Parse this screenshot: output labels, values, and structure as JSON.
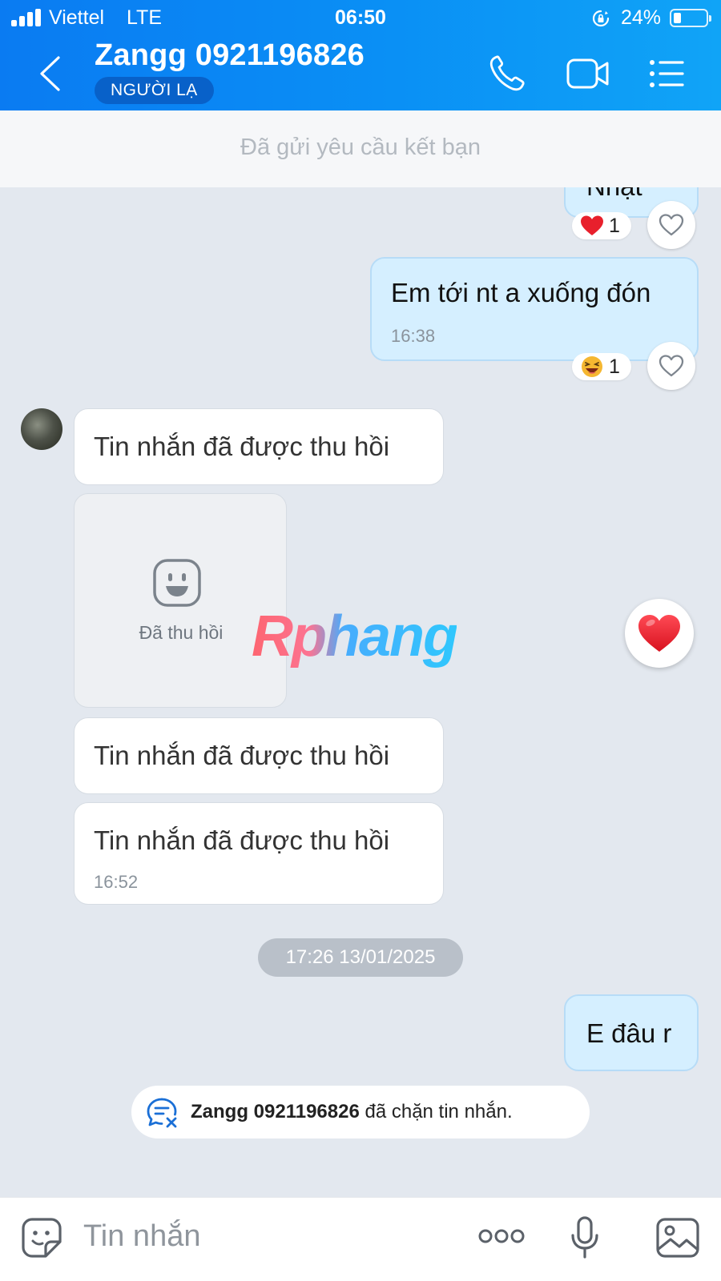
{
  "status_bar": {
    "carrier": "Viettel",
    "network": "LTE",
    "time": "06:50",
    "battery_percent": "24%",
    "battery_level": 0.24
  },
  "header": {
    "title": "Zangg 0921196826",
    "badge": "NGƯỜI LẠ",
    "icons": [
      "back-icon",
      "phone-icon",
      "video-call-icon",
      "menu-list-icon"
    ]
  },
  "friend_request": {
    "label": "Đã gửi yêu cầu kết bạn"
  },
  "messages": {
    "m0": {
      "text": "Nhật",
      "reaction_count": "1",
      "reaction": "red-heart"
    },
    "m1": {
      "text": "Em tới nt a xuống đón",
      "time": "16:38",
      "reaction_count": "1",
      "reaction": "laughing-face"
    },
    "m2": {
      "text": "Tin nhắn đã được thu hồi"
    },
    "m3": {
      "label": "Đã thu hồi"
    },
    "m4": {
      "text": "Tin nhắn đã được thu hồi"
    },
    "m5": {
      "text": "Tin nhắn đã được thu hồi",
      "time": "16:52"
    },
    "m6": {
      "text": "E đâu r"
    }
  },
  "date_separator": "17:26 13/01/2025",
  "watermark": "Rphang",
  "block_notice": {
    "name": "Zangg 0921196826",
    "text": "đã chặn tin nhắn."
  },
  "input_bar": {
    "placeholder": "Tin nhắn",
    "icons": [
      "sticker-icon",
      "more-dots-icon",
      "microphone-icon",
      "image-icon"
    ]
  },
  "colors": {
    "header_blue": "#0a84f3",
    "outgoing_bubble": "#d5efff",
    "chat_background": "#e3e8ef"
  }
}
